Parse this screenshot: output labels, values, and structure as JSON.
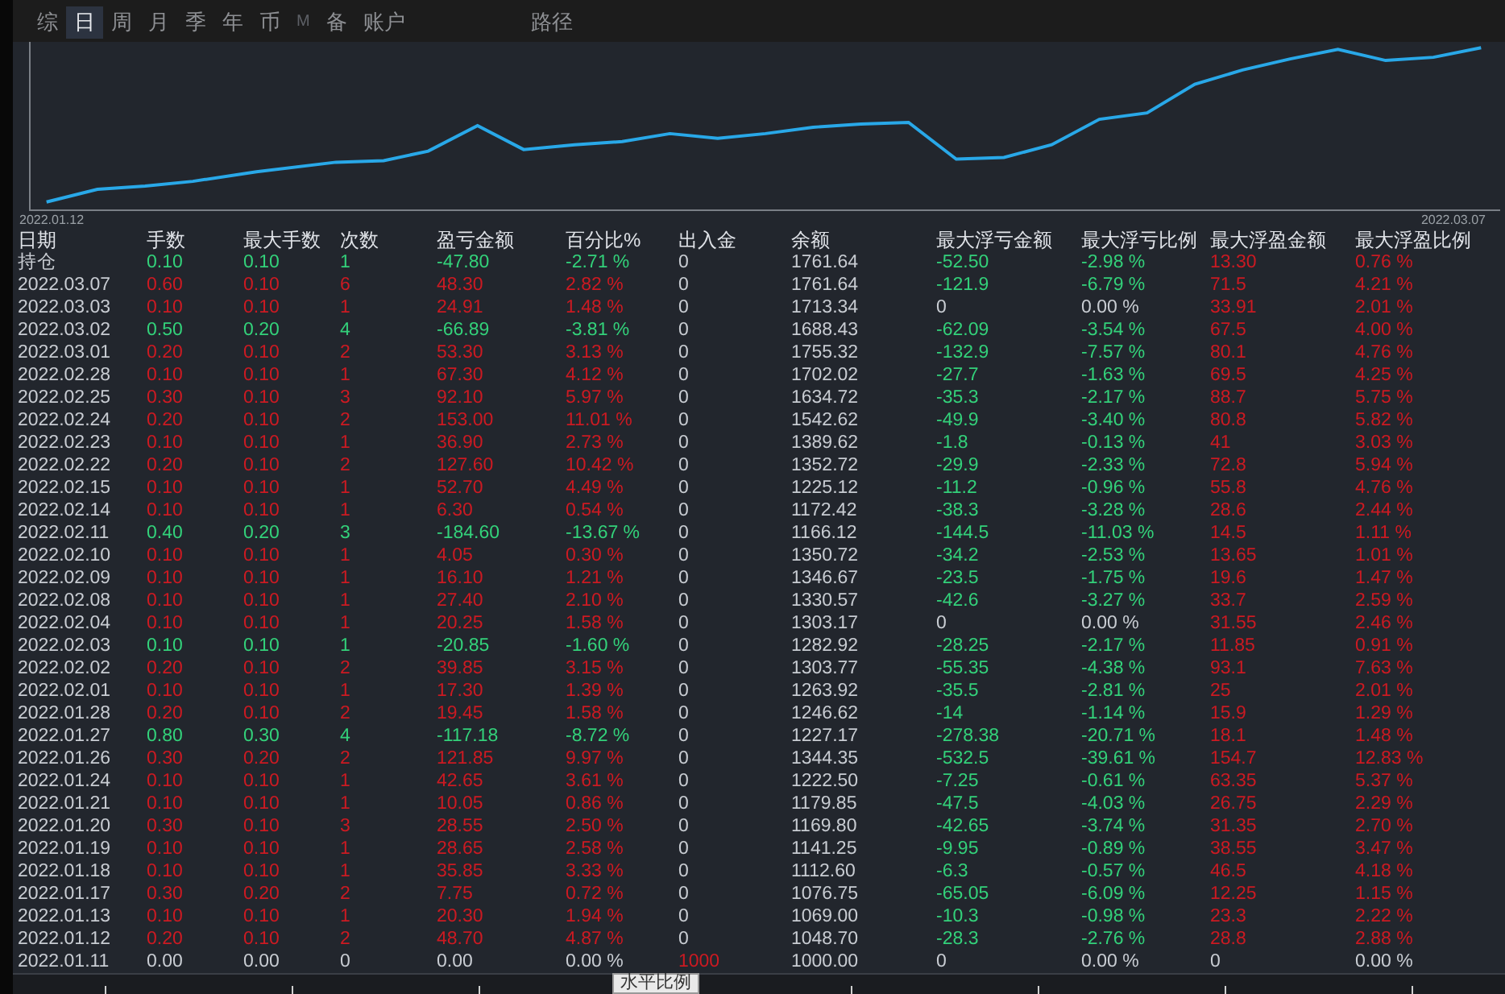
{
  "tabs": [
    {
      "label": "综",
      "selected": false,
      "disabled": false
    },
    {
      "label": "日",
      "selected": true,
      "disabled": false
    },
    {
      "label": "周",
      "selected": false,
      "disabled": false
    },
    {
      "label": "月",
      "selected": false,
      "disabled": false
    },
    {
      "label": "季",
      "selected": false,
      "disabled": false
    },
    {
      "label": "年",
      "selected": false,
      "disabled": false
    },
    {
      "label": "币",
      "selected": false,
      "disabled": false
    },
    {
      "label": "M",
      "selected": false,
      "disabled": true
    },
    {
      "label": "备",
      "selected": false,
      "disabled": false
    },
    {
      "label": "账户",
      "selected": false,
      "disabled": false
    }
  ],
  "path_tab": {
    "label": "路径",
    "selected": false
  },
  "chart": {
    "kind": "picture",
    "start_label": "2022.01.12",
    "end_label": "2022.03.07"
  },
  "table": {
    "columns": [
      "日期",
      "手数",
      "最大手数",
      "次数",
      "盈亏金额",
      "百分比%",
      "出入金",
      "余额",
      "最大浮亏金额",
      "最大浮亏比例",
      "最大浮盈金额",
      "最大浮盈比例"
    ],
    "rows": [
      {
        "profit": false,
        "loss": true,
        "deposit": false,
        "float_loss": true,
        "float_profit": true,
        "cells": [
          "持仓",
          "0.10",
          "0.10",
          "1",
          "-47.80",
          "-2.71 %",
          "0",
          "1761.64",
          "-52.50",
          "-2.98 %",
          "13.30",
          "0.76 %"
        ]
      },
      {
        "profit": true,
        "loss": false,
        "deposit": false,
        "float_loss": true,
        "float_profit": true,
        "cells": [
          "2022.03.07",
          "0.60",
          "0.10",
          "6",
          "48.30",
          "2.82 %",
          "0",
          "1761.64",
          "-121.9",
          "-6.79 %",
          "71.5",
          "4.21 %"
        ]
      },
      {
        "profit": true,
        "loss": false,
        "deposit": false,
        "float_loss": false,
        "float_profit": true,
        "cells": [
          "2022.03.03",
          "0.10",
          "0.10",
          "1",
          "24.91",
          "1.48 %",
          "0",
          "1713.34",
          "0",
          "0.00 %",
          "33.91",
          "2.01 %"
        ]
      },
      {
        "profit": false,
        "loss": true,
        "deposit": false,
        "float_loss": true,
        "float_profit": true,
        "cells": [
          "2022.03.02",
          "0.50",
          "0.20",
          "4",
          "-66.89",
          "-3.81 %",
          "0",
          "1688.43",
          "-62.09",
          "-3.54 %",
          "67.5",
          "4.00 %"
        ]
      },
      {
        "profit": true,
        "loss": false,
        "deposit": false,
        "float_loss": true,
        "float_profit": true,
        "cells": [
          "2022.03.01",
          "0.20",
          "0.10",
          "2",
          "53.30",
          "3.13 %",
          "0",
          "1755.32",
          "-132.9",
          "-7.57 %",
          "80.1",
          "4.76 %"
        ]
      },
      {
        "profit": true,
        "loss": false,
        "deposit": false,
        "float_loss": true,
        "float_profit": true,
        "cells": [
          "2022.02.28",
          "0.10",
          "0.10",
          "1",
          "67.30",
          "4.12 %",
          "0",
          "1702.02",
          "-27.7",
          "-1.63 %",
          "69.5",
          "4.25 %"
        ]
      },
      {
        "profit": true,
        "loss": false,
        "deposit": false,
        "float_loss": true,
        "float_profit": true,
        "cells": [
          "2022.02.25",
          "0.30",
          "0.10",
          "3",
          "92.10",
          "5.97 %",
          "0",
          "1634.72",
          "-35.3",
          "-2.17 %",
          "88.7",
          "5.75 %"
        ]
      },
      {
        "profit": true,
        "loss": false,
        "deposit": false,
        "float_loss": true,
        "float_profit": true,
        "cells": [
          "2022.02.24",
          "0.20",
          "0.10",
          "2",
          "153.00",
          "11.01 %",
          "0",
          "1542.62",
          "-49.9",
          "-3.40 %",
          "80.8",
          "5.82 %"
        ]
      },
      {
        "profit": true,
        "loss": false,
        "deposit": false,
        "float_loss": true,
        "float_profit": true,
        "cells": [
          "2022.02.23",
          "0.10",
          "0.10",
          "1",
          "36.90",
          "2.73 %",
          "0",
          "1389.62",
          "-1.8",
          "-0.13 %",
          "41",
          "3.03 %"
        ]
      },
      {
        "profit": true,
        "loss": false,
        "deposit": false,
        "float_loss": true,
        "float_profit": true,
        "cells": [
          "2022.02.22",
          "0.20",
          "0.10",
          "2",
          "127.60",
          "10.42 %",
          "0",
          "1352.72",
          "-29.9",
          "-2.33 %",
          "72.8",
          "5.94 %"
        ]
      },
      {
        "profit": true,
        "loss": false,
        "deposit": false,
        "float_loss": true,
        "float_profit": true,
        "cells": [
          "2022.02.15",
          "0.10",
          "0.10",
          "1",
          "52.70",
          "4.49 %",
          "0",
          "1225.12",
          "-11.2",
          "-0.96 %",
          "55.8",
          "4.76 %"
        ]
      },
      {
        "profit": true,
        "loss": false,
        "deposit": false,
        "float_loss": true,
        "float_profit": true,
        "cells": [
          "2022.02.14",
          "0.10",
          "0.10",
          "1",
          "6.30",
          "0.54 %",
          "0",
          "1172.42",
          "-38.3",
          "-3.28 %",
          "28.6",
          "2.44 %"
        ]
      },
      {
        "profit": false,
        "loss": true,
        "deposit": false,
        "float_loss": true,
        "float_profit": true,
        "cells": [
          "2022.02.11",
          "0.40",
          "0.20",
          "3",
          "-184.60",
          "-13.67 %",
          "0",
          "1166.12",
          "-144.5",
          "-11.03 %",
          "14.5",
          "1.11 %"
        ]
      },
      {
        "profit": true,
        "loss": false,
        "deposit": false,
        "float_loss": true,
        "float_profit": true,
        "cells": [
          "2022.02.10",
          "0.10",
          "0.10",
          "1",
          "4.05",
          "0.30 %",
          "0",
          "1350.72",
          "-34.2",
          "-2.53 %",
          "13.65",
          "1.01 %"
        ]
      },
      {
        "profit": true,
        "loss": false,
        "deposit": false,
        "float_loss": true,
        "float_profit": true,
        "cells": [
          "2022.02.09",
          "0.10",
          "0.10",
          "1",
          "16.10",
          "1.21 %",
          "0",
          "1346.67",
          "-23.5",
          "-1.75 %",
          "19.6",
          "1.47 %"
        ]
      },
      {
        "profit": true,
        "loss": false,
        "deposit": false,
        "float_loss": true,
        "float_profit": true,
        "cells": [
          "2022.02.08",
          "0.10",
          "0.10",
          "1",
          "27.40",
          "2.10 %",
          "0",
          "1330.57",
          "-42.6",
          "-3.27 %",
          "33.7",
          "2.59 %"
        ]
      },
      {
        "profit": true,
        "loss": false,
        "deposit": false,
        "float_loss": false,
        "float_profit": true,
        "cells": [
          "2022.02.04",
          "0.10",
          "0.10",
          "1",
          "20.25",
          "1.58 %",
          "0",
          "1303.17",
          "0",
          "0.00 %",
          "31.55",
          "2.46 %"
        ]
      },
      {
        "profit": false,
        "loss": true,
        "deposit": false,
        "float_loss": true,
        "float_profit": true,
        "cells": [
          "2022.02.03",
          "0.10",
          "0.10",
          "1",
          "-20.85",
          "-1.60 %",
          "0",
          "1282.92",
          "-28.25",
          "-2.17 %",
          "11.85",
          "0.91 %"
        ]
      },
      {
        "profit": true,
        "loss": false,
        "deposit": false,
        "float_loss": true,
        "float_profit": true,
        "cells": [
          "2022.02.02",
          "0.20",
          "0.10",
          "2",
          "39.85",
          "3.15 %",
          "0",
          "1303.77",
          "-55.35",
          "-4.38 %",
          "93.1",
          "7.63 %"
        ]
      },
      {
        "profit": true,
        "loss": false,
        "deposit": false,
        "float_loss": true,
        "float_profit": true,
        "cells": [
          "2022.02.01",
          "0.10",
          "0.10",
          "1",
          "17.30",
          "1.39 %",
          "0",
          "1263.92",
          "-35.5",
          "-2.81 %",
          "25",
          "2.01 %"
        ]
      },
      {
        "profit": true,
        "loss": false,
        "deposit": false,
        "float_loss": true,
        "float_profit": true,
        "cells": [
          "2022.01.28",
          "0.20",
          "0.10",
          "2",
          "19.45",
          "1.58 %",
          "0",
          "1246.62",
          "-14",
          "-1.14 %",
          "15.9",
          "1.29 %"
        ]
      },
      {
        "profit": false,
        "loss": true,
        "deposit": false,
        "float_loss": true,
        "float_profit": true,
        "cells": [
          "2022.01.27",
          "0.80",
          "0.30",
          "4",
          "-117.18",
          "-8.72 %",
          "0",
          "1227.17",
          "-278.38",
          "-20.71 %",
          "18.1",
          "1.48 %"
        ]
      },
      {
        "profit": true,
        "loss": false,
        "deposit": false,
        "float_loss": true,
        "float_profit": true,
        "cells": [
          "2022.01.26",
          "0.30",
          "0.20",
          "2",
          "121.85",
          "9.97 %",
          "0",
          "1344.35",
          "-532.5",
          "-39.61 %",
          "154.7",
          "12.83 %"
        ]
      },
      {
        "profit": true,
        "loss": false,
        "deposit": false,
        "float_loss": true,
        "float_profit": true,
        "cells": [
          "2022.01.24",
          "0.10",
          "0.10",
          "1",
          "42.65",
          "3.61 %",
          "0",
          "1222.50",
          "-7.25",
          "-0.61 %",
          "63.35",
          "5.37 %"
        ]
      },
      {
        "profit": true,
        "loss": false,
        "deposit": false,
        "float_loss": true,
        "float_profit": true,
        "cells": [
          "2022.01.21",
          "0.10",
          "0.10",
          "1",
          "10.05",
          "0.86 %",
          "0",
          "1179.85",
          "-47.5",
          "-4.03 %",
          "26.75",
          "2.29 %"
        ]
      },
      {
        "profit": true,
        "loss": false,
        "deposit": false,
        "float_loss": true,
        "float_profit": true,
        "cells": [
          "2022.01.20",
          "0.30",
          "0.10",
          "3",
          "28.55",
          "2.50 %",
          "0",
          "1169.80",
          "-42.65",
          "-3.74 %",
          "31.35",
          "2.70 %"
        ]
      },
      {
        "profit": true,
        "loss": false,
        "deposit": false,
        "float_loss": true,
        "float_profit": true,
        "cells": [
          "2022.01.19",
          "0.10",
          "0.10",
          "1",
          "28.65",
          "2.58 %",
          "0",
          "1141.25",
          "-9.95",
          "-0.89 %",
          "38.55",
          "3.47 %"
        ]
      },
      {
        "profit": true,
        "loss": false,
        "deposit": false,
        "float_loss": true,
        "float_profit": true,
        "cells": [
          "2022.01.18",
          "0.10",
          "0.10",
          "1",
          "35.85",
          "3.33 %",
          "0",
          "1112.60",
          "-6.3",
          "-0.57 %",
          "46.5",
          "4.18 %"
        ]
      },
      {
        "profit": true,
        "loss": false,
        "deposit": false,
        "float_loss": true,
        "float_profit": true,
        "cells": [
          "2022.01.17",
          "0.30",
          "0.20",
          "2",
          "7.75",
          "0.72 %",
          "0",
          "1076.75",
          "-65.05",
          "-6.09 %",
          "12.25",
          "1.15 %"
        ]
      },
      {
        "profit": true,
        "loss": false,
        "deposit": false,
        "float_loss": true,
        "float_profit": true,
        "cells": [
          "2022.01.13",
          "0.10",
          "0.10",
          "1",
          "20.30",
          "1.94 %",
          "0",
          "1069.00",
          "-10.3",
          "-0.98 %",
          "23.3",
          "2.22 %"
        ]
      },
      {
        "profit": true,
        "loss": false,
        "deposit": false,
        "float_loss": true,
        "float_profit": true,
        "cells": [
          "2022.01.12",
          "0.20",
          "0.10",
          "2",
          "48.70",
          "4.87 %",
          "0",
          "1048.70",
          "-28.3",
          "-2.76 %",
          "28.8",
          "2.88 %"
        ]
      },
      {
        "profit": false,
        "loss": false,
        "deposit": true,
        "float_loss": false,
        "float_profit": false,
        "cells": [
          "2022.01.11",
          "0.00",
          "0.00",
          "0",
          "0.00",
          "0.00 %",
          "1000",
          "1000.00",
          "0",
          "0.00 %",
          "0",
          "0.00 %"
        ]
      }
    ]
  },
  "tooltip": "水平比例"
}
